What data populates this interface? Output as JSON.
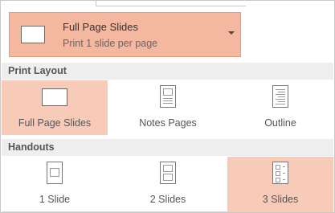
{
  "selector": {
    "title": "Full Page Slides",
    "subtitle": "Print 1 slide per page",
    "icon": "full-page-slide-icon",
    "dropdown_icon": "caret-down-icon"
  },
  "sections": [
    {
      "label": "Print Layout"
    },
    {
      "label": "Handouts"
    }
  ],
  "print_layout": [
    {
      "label": "Full Page Slides",
      "icon": "full-page-slides-icon",
      "selected": true
    },
    {
      "label": "Notes Pages",
      "icon": "notes-pages-icon",
      "selected": false
    },
    {
      "label": "Outline",
      "icon": "outline-icon",
      "selected": false
    }
  ],
  "handouts": [
    {
      "label": "1 Slide",
      "icon": "one-slide-handout-icon",
      "selected": false
    },
    {
      "label": "2 Slides",
      "icon": "two-slides-handout-icon",
      "selected": false
    },
    {
      "label": "3 Slides",
      "icon": "three-slides-handout-icon",
      "selected": true
    }
  ],
  "colors": {
    "selected": "#f7cbb8",
    "selector_bg": "#f4b8a0"
  }
}
